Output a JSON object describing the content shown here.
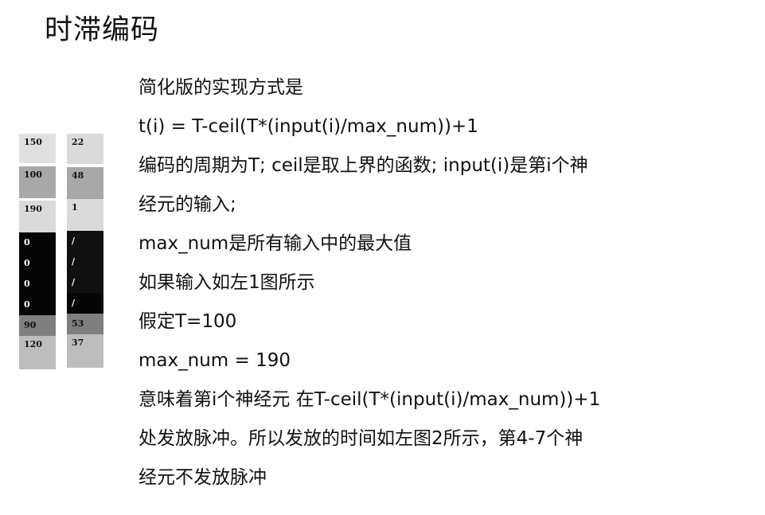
{
  "title": "时滞编码",
  "input_column": [
    {
      "value": "150",
      "bg": "#e0e0e0",
      "fg": "#111111"
    },
    {
      "value": "100",
      "bg": "#a8a8a8",
      "fg": "#111111"
    },
    {
      "value": "190",
      "bg": "#dadada",
      "fg": "#111111"
    },
    {
      "value": "0",
      "bg": "#050505",
      "fg": "#ffffff"
    },
    {
      "value": "0",
      "bg": "#050505",
      "fg": "#ffffff"
    },
    {
      "value": "0",
      "bg": "#050505",
      "fg": "#ffffff"
    },
    {
      "value": "0",
      "bg": "#050505",
      "fg": "#ffffff"
    },
    {
      "value": "90",
      "bg": "#7f7f7f",
      "fg": "#111111"
    },
    {
      "value": "120",
      "bg": "#bdbdbd",
      "fg": "#111111"
    }
  ],
  "time_column": [
    {
      "value": "22",
      "bg": "#dadada",
      "fg": "#111111"
    },
    {
      "value": "48",
      "bg": "#a8a8a8",
      "fg": "#111111"
    },
    {
      "value": "1",
      "bg": "#dadada",
      "fg": "#111111"
    },
    {
      "value": "/",
      "bg": "#101010",
      "fg": "#ffffff"
    },
    {
      "value": "/",
      "bg": "#101010",
      "fg": "#ffffff"
    },
    {
      "value": "/",
      "bg": "#101010",
      "fg": "#ffffff"
    },
    {
      "value": "/",
      "bg": "#050505",
      "fg": "#ffffff"
    },
    {
      "value": "53",
      "bg": "#7f7f7f",
      "fg": "#111111"
    },
    {
      "value": "37",
      "bg": "#bdbdbd",
      "fg": "#111111"
    }
  ],
  "lines": [
    "简化版的实现方式是",
    "t(i) = T-ceil(T*(input(i)/max_num))+1",
    "编码的周期为T; ceil是取上界的函数; input(i)是第i个神",
    "经元的输入;",
    "max_num是所有输入中的最大值",
    "如果输入如左1图所示",
    "假定T=100",
    "max_num = 190",
    "意味着第i个神经元 在T-ceil(T*(input(i)/max_num))+1",
    "处发放脉冲。所以发放的时间如左图2所示，第4-7个神",
    "经元不发放脉冲"
  ]
}
